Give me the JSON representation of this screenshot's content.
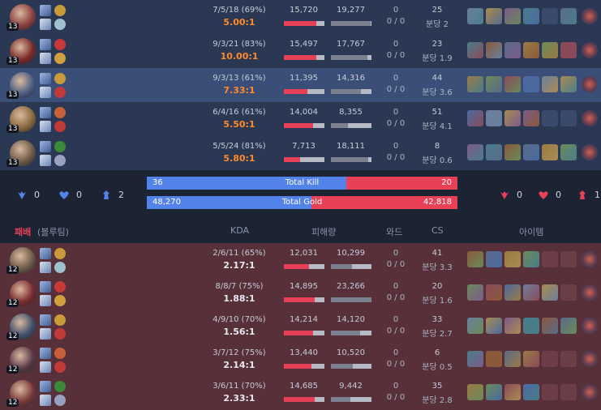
{
  "colors": {
    "blue": "#5383e8",
    "red": "#e84057",
    "ratio_orange": "#ff8a2a",
    "win_bg": "#2a3854",
    "lose_bg": "#573039"
  },
  "winning_team": {
    "players": [
      {
        "level": "13",
        "kda": "7/5/18 (69%)",
        "ratio": "5.00:1",
        "ratio_style": "o",
        "damage_dealt": "15,720",
        "damage_taken": "19,277",
        "dealt_frac": 0.8,
        "taken_frac": 0.97,
        "wards": "0",
        "wards_detail": "0 / 0",
        "cs": "25",
        "cs_per_min": "분당 2",
        "items": [
          "item",
          "item",
          "item",
          "item",
          "empty",
          "item",
          "trinket"
        ]
      },
      {
        "level": "13",
        "kda": "9/3/21 (83%)",
        "ratio": "10.00:1",
        "ratio_style": "o",
        "damage_dealt": "15,497",
        "damage_taken": "17,767",
        "dealt_frac": 0.79,
        "taken_frac": 0.9,
        "wards": "0",
        "wards_detail": "0 / 0",
        "cs": "23",
        "cs_per_min": "분당 1.9",
        "items": [
          "item",
          "item",
          "item",
          "item",
          "item",
          "item",
          "trinket"
        ]
      },
      {
        "level": "13",
        "kda": "9/3/13 (61%)",
        "ratio": "7.33:1",
        "ratio_style": "o",
        "damage_dealt": "11,395",
        "damage_taken": "14,316",
        "dealt_frac": 0.58,
        "taken_frac": 0.73,
        "wards": "0",
        "wards_detail": "0 / 0",
        "cs": "44",
        "cs_per_min": "분당 3.6",
        "items": [
          "item",
          "item",
          "item",
          "item",
          "item",
          "item",
          "trinket"
        ],
        "highlight": true
      },
      {
        "level": "13",
        "kda": "6/4/16 (61%)",
        "ratio": "5.50:1",
        "ratio_style": "o",
        "damage_dealt": "14,004",
        "damage_taken": "8,355",
        "dealt_frac": 0.71,
        "taken_frac": 0.42,
        "wards": "0",
        "wards_detail": "0 / 0",
        "cs": "51",
        "cs_per_min": "분당 4.1",
        "items": [
          "item",
          "item",
          "item",
          "item",
          "empty",
          "empty",
          "trinket"
        ]
      },
      {
        "level": "13",
        "kda": "5/5/24 (81%)",
        "ratio": "5.80:1",
        "ratio_style": "o",
        "damage_dealt": "7,713",
        "damage_taken": "18,111",
        "dealt_frac": 0.39,
        "taken_frac": 0.92,
        "wards": "0",
        "wards_detail": "0 / 0",
        "cs": "8",
        "cs_per_min": "분당 0.6",
        "items": [
          "item",
          "item",
          "item",
          "item",
          "item",
          "item",
          "trinket"
        ]
      }
    ]
  },
  "objectives_left": [
    {
      "icon": "baron-icon",
      "value": "0"
    },
    {
      "icon": "dragon-icon",
      "value": "0"
    },
    {
      "icon": "tower-icon",
      "value": "2"
    }
  ],
  "objectives_right": [
    {
      "icon": "baron-icon",
      "value": "0"
    },
    {
      "icon": "dragon-icon",
      "value": "0"
    },
    {
      "icon": "tower-icon",
      "value": "1"
    }
  ],
  "total_kill": {
    "label": "Total Kill",
    "left": "36",
    "right": "20",
    "left_frac": 0.643
  },
  "total_gold": {
    "label": "Total Gold",
    "left": "48,270",
    "right": "42,818",
    "left_frac": 0.53
  },
  "losing_header": {
    "result": "패배",
    "team": "(블루팀)",
    "kda": "KDA",
    "damage": "피해량",
    "wards": "와드",
    "cs": "CS",
    "items": "아이템"
  },
  "losing_team": {
    "players": [
      {
        "level": "12",
        "kda": "2/6/11 (65%)",
        "ratio": "2.17:1",
        "ratio_style": "w",
        "damage_dealt": "12,031",
        "damage_taken": "10,299",
        "dealt_frac": 0.61,
        "taken_frac": 0.52,
        "wards": "0",
        "wards_detail": "0 / 0",
        "cs": "41",
        "cs_per_min": "분당 3.3",
        "items": [
          "item",
          "item",
          "item",
          "item",
          "empty",
          "empty",
          "trinket"
        ]
      },
      {
        "level": "12",
        "kda": "8/8/7 (75%)",
        "ratio": "1.88:1",
        "ratio_style": "w",
        "damage_dealt": "14,895",
        "damage_taken": "23,266",
        "dealt_frac": 0.76,
        "taken_frac": 1.0,
        "wards": "0",
        "wards_detail": "0 / 0",
        "cs": "20",
        "cs_per_min": "분당 1.6",
        "items": [
          "item",
          "item",
          "item",
          "item",
          "item",
          "empty",
          "trinket"
        ]
      },
      {
        "level": "12",
        "kda": "4/9/10 (70%)",
        "ratio": "1.56:1",
        "ratio_style": "w",
        "damage_dealt": "14,214",
        "damage_taken": "14,120",
        "dealt_frac": 0.72,
        "taken_frac": 0.72,
        "wards": "0",
        "wards_detail": "0 / 0",
        "cs": "33",
        "cs_per_min": "분당 2.7",
        "items": [
          "item",
          "item",
          "item",
          "item",
          "item",
          "item",
          "trinket"
        ]
      },
      {
        "level": "12",
        "kda": "3/7/12 (75%)",
        "ratio": "2.14:1",
        "ratio_style": "w",
        "damage_dealt": "13,440",
        "damage_taken": "10,520",
        "dealt_frac": 0.68,
        "taken_frac": 0.53,
        "wards": "0",
        "wards_detail": "0 / 0",
        "cs": "6",
        "cs_per_min": "분당 0.5",
        "items": [
          "item",
          "item",
          "item",
          "item",
          "empty",
          "empty",
          "trinket"
        ]
      },
      {
        "level": "12",
        "kda": "3/6/11 (70%)",
        "ratio": "2.33:1",
        "ratio_style": "w",
        "damage_dealt": "14,685",
        "damage_taken": "9,442",
        "dealt_frac": 0.75,
        "taken_frac": 0.48,
        "wards": "0",
        "wards_detail": "0 / 0",
        "cs": "35",
        "cs_per_min": "분당 2.8",
        "items": [
          "item",
          "item",
          "item",
          "item",
          "empty",
          "empty",
          "trinket"
        ]
      }
    ]
  }
}
